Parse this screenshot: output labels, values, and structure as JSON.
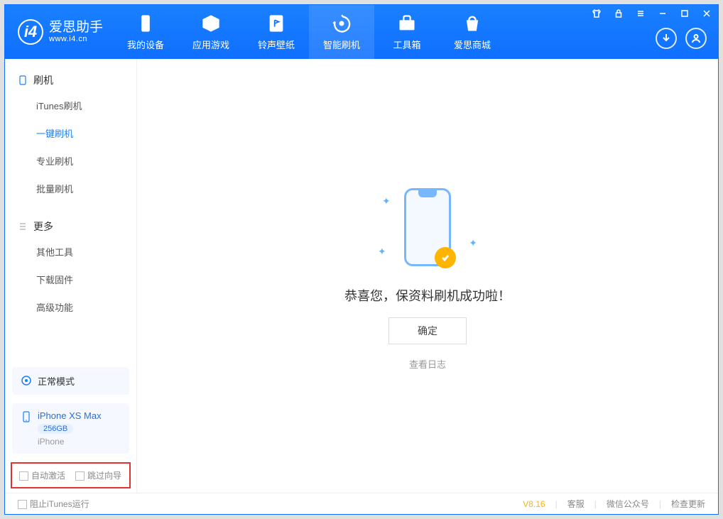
{
  "app": {
    "name": "爱思助手",
    "url": "www.i4.cn"
  },
  "nav": {
    "tabs": [
      {
        "label": "我的设备"
      },
      {
        "label": "应用游戏"
      },
      {
        "label": "铃声壁纸"
      },
      {
        "label": "智能刷机"
      },
      {
        "label": "工具箱"
      },
      {
        "label": "爱思商城"
      }
    ]
  },
  "sidebar": {
    "section1": {
      "title": "刷机",
      "items": [
        {
          "label": "iTunes刷机"
        },
        {
          "label": "一键刷机"
        },
        {
          "label": "专业刷机"
        },
        {
          "label": "批量刷机"
        }
      ]
    },
    "section2": {
      "title": "更多",
      "items": [
        {
          "label": "其他工具"
        },
        {
          "label": "下载固件"
        },
        {
          "label": "高级功能"
        }
      ]
    },
    "mode": {
      "label": "正常模式"
    },
    "device": {
      "name": "iPhone XS Max",
      "capacity": "256GB",
      "type": "iPhone"
    },
    "opts": {
      "auto_activate": "自动激活",
      "skip_guide": "跳过向导"
    }
  },
  "main": {
    "message": "恭喜您，保资料刷机成功啦！",
    "confirm": "确定",
    "view_log": "查看日志"
  },
  "footer": {
    "block_itunes": "阻止iTunes运行",
    "version": "V8.16",
    "support": "客服",
    "wechat": "微信公众号",
    "check_update": "检查更新"
  }
}
